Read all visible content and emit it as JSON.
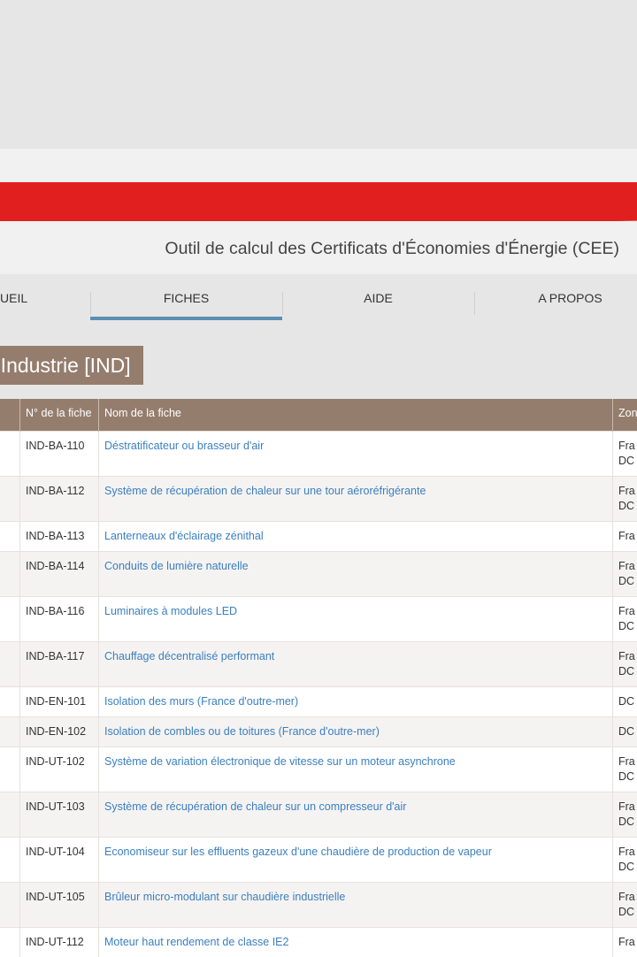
{
  "header": {
    "subtitle": "Outil de calcul des Certificats d'Économies d'Énergie (CEE)"
  },
  "nav": {
    "items": [
      {
        "label": "UEIL"
      },
      {
        "label": "FICHES"
      },
      {
        "label": "AIDE"
      },
      {
        "label": "A PROPOS"
      }
    ],
    "active": "FICHES"
  },
  "section": {
    "title": "es Industrie [IND]"
  },
  "table": {
    "headers": [
      "",
      "N° de la fiche",
      "Nom de la fiche",
      "Zon"
    ],
    "rows": [
      {
        "num": "IND-BA-110",
        "name": "Déstratificateur ou brasseur d'air",
        "zone": [
          "Fra",
          "DC"
        ]
      },
      {
        "num": "IND-BA-112",
        "name": "Système de récupération de chaleur sur une tour aéroréfrigérante",
        "zone": [
          "Fra",
          "DC"
        ]
      },
      {
        "num": "IND-BA-113",
        "name": "Lanterneaux d'éclairage zénithal",
        "zone": [
          "Fra"
        ]
      },
      {
        "num": "IND-BA-114",
        "name": "Conduits de lumière naturelle",
        "zone": [
          "Fra",
          "DC"
        ]
      },
      {
        "num": "IND-BA-116",
        "name": "Luminaires à modules LED",
        "zone": [
          "Fra",
          "DC"
        ]
      },
      {
        "num": "IND-BA-117",
        "name": "Chauffage décentralisé performant",
        "zone": [
          "Fra",
          "DC"
        ]
      },
      {
        "num": "IND-EN-101",
        "name": "Isolation des murs (France d'outre-mer)",
        "zone": [
          "DC"
        ]
      },
      {
        "num": "IND-EN-102",
        "name": "Isolation de combles ou de toitures (France d'outre-mer)",
        "zone": [
          "DC"
        ]
      },
      {
        "num": "IND-UT-102",
        "name": "Système de variation électronique de vitesse sur un moteur asynchrone",
        "zone": [
          "Fra",
          "DC"
        ]
      },
      {
        "num": "IND-UT-103",
        "name": "Système de récupération de chaleur sur un compresseur d'air",
        "zone": [
          "Fra",
          "DC"
        ]
      },
      {
        "num": "IND-UT-104",
        "name": "Economiseur sur les effluents gazeux d'une chaudière de production de vapeur",
        "zone": [
          "Fra",
          "DC"
        ]
      },
      {
        "num": "IND-UT-105",
        "name": "Brûleur micro-modulant sur chaudière industrielle",
        "zone": [
          "Fra",
          "DC"
        ]
      },
      {
        "num": "IND-UT-112",
        "name": "Moteur haut rendement de classe IE2",
        "zone": [
          "Fra"
        ]
      }
    ]
  }
}
